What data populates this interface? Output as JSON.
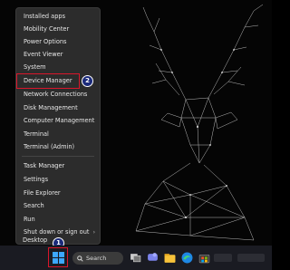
{
  "menu": {
    "items": [
      {
        "label": "Installed apps"
      },
      {
        "label": "Mobility Center"
      },
      {
        "label": "Power Options"
      },
      {
        "label": "Event Viewer"
      },
      {
        "label": "System"
      },
      {
        "label": "Device Manager"
      },
      {
        "label": "Network Connections"
      },
      {
        "label": "Disk Management"
      },
      {
        "label": "Computer Management"
      },
      {
        "label": "Terminal"
      },
      {
        "label": "Terminal (Admin)"
      },
      {
        "label": "Task Manager"
      },
      {
        "label": "Settings"
      },
      {
        "label": "File Explorer"
      },
      {
        "label": "Search"
      },
      {
        "label": "Run"
      },
      {
        "label": "Shut down or sign out",
        "chevron": "›"
      },
      {
        "label": "Desktop"
      }
    ]
  },
  "badges": {
    "step1": "1",
    "step2": "2"
  },
  "taskbar": {
    "search_label": "Search"
  },
  "colors": {
    "highlight": "#d9162b",
    "badge": "#1b2a7a",
    "taskbar": "#1a1b22",
    "menu_bg": "#2c2c2c"
  },
  "icons": [
    "windows-start-icon",
    "search-icon",
    "task-view-icon",
    "chat-icon",
    "file-explorer-icon",
    "edge-icon",
    "store-icon"
  ]
}
